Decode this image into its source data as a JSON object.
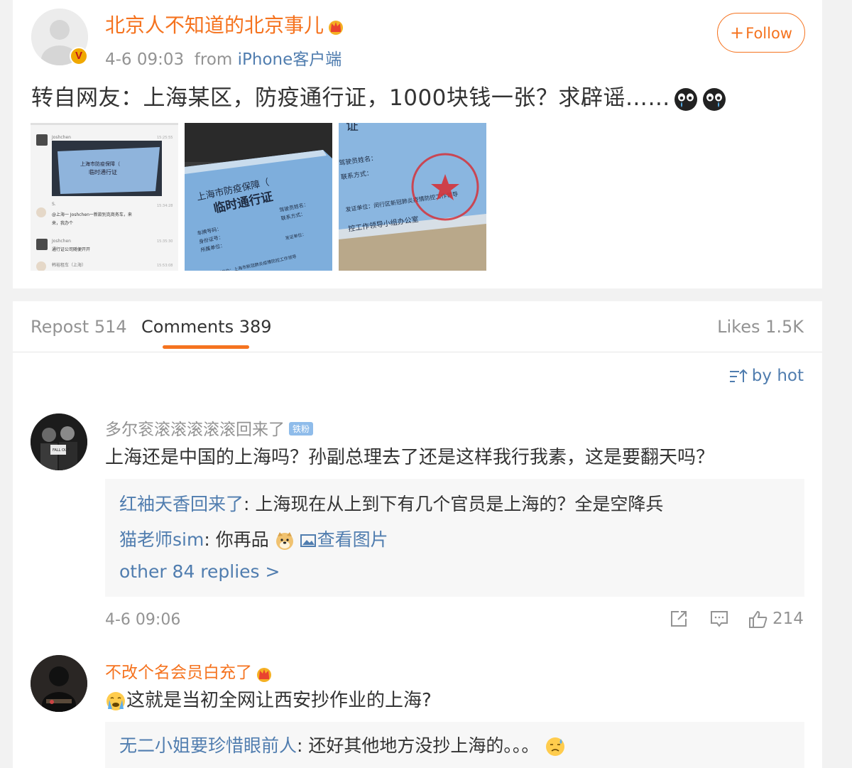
{
  "post": {
    "author": "北京人不知道的北京事儿",
    "timestamp": "4-6 09:03",
    "from_label": "from",
    "source": "iPhone客户端",
    "follow_label": "Follow",
    "text": "转自网友：上海某区，防疫通行证，1000块钱一张？求辟谣……",
    "images": [
      {
        "icon": "chat-screenshot",
        "chat": {
          "user1": "Joshchen",
          "time1": "15:25:55",
          "doc1": "上海市防疫保障（",
          "doc2": "临时通行证",
          "user2": "S.",
          "time2": "15:34:28",
          "msg2a": "@上海一 Joshchen一新款别克商务车，来",
          "msg2b": "来，我办个",
          "user3": "Joshchen",
          "time3": "15:35:30",
          "msg3": "通行证公司随便开开",
          "user4": "韩裕租车（上海）",
          "time4": "15:53:08"
        }
      },
      {
        "icon": "permit-photo",
        "doc": {
          "title1": "上海市防疫保障（",
          "title2": "临时通行证",
          "f1": "车牌号码：",
          "f2": "身份证号：",
          "f3": "所属单位：",
          "f4": "驾驶员姓名：",
          "f5": "联系方式：",
          "f6": "发证单位：",
          "f7": "监制单位：上海市新冠肺炎疫情防控工作领导"
        }
      },
      {
        "icon": "permit-stamp-photo",
        "doc": {
          "f1": "驾驶员姓名：",
          "f2": "联系方式：",
          "f3": "发证单位：闵行区新冠肺炎疫情防控工作领导",
          "f4": "控工作领导小组办公室"
        }
      }
    ]
  },
  "tabs": {
    "repost": "Repost 514",
    "comments": "Comments 389",
    "likes": "Likes 1.5K"
  },
  "sort": {
    "label": "by hot",
    "icon": "sort-icon"
  },
  "comments": [
    {
      "user": "多尔衮滚滚滚滚滚回来了",
      "badge": "铁粉",
      "text": "上海还是中国的上海吗？孙副总理去了还是这样我行我素，这是要翻天吗？",
      "replies": [
        {
          "user": "红袖天香回来了",
          "text": "上海现在从上到下有几个官员是上海的？全是空降兵"
        },
        {
          "user": "猫老师sim",
          "text": "你再品",
          "view_image": "查看图片"
        }
      ],
      "more_replies": "other 84 replies >",
      "time": "4-6 09:06",
      "likes": "214"
    },
    {
      "user": "不改个名会员白充了",
      "text": "这就是当初全网让西安抄作业的上海?",
      "replies": [
        {
          "user": "无二小姐要珍惜眼前人",
          "text": "还好其他地方没抄上海的。。。"
        }
      ]
    }
  ],
  "colors": {
    "accent": "#f5731f",
    "link": "#507daf",
    "muted": "#939393",
    "text": "#333333"
  }
}
